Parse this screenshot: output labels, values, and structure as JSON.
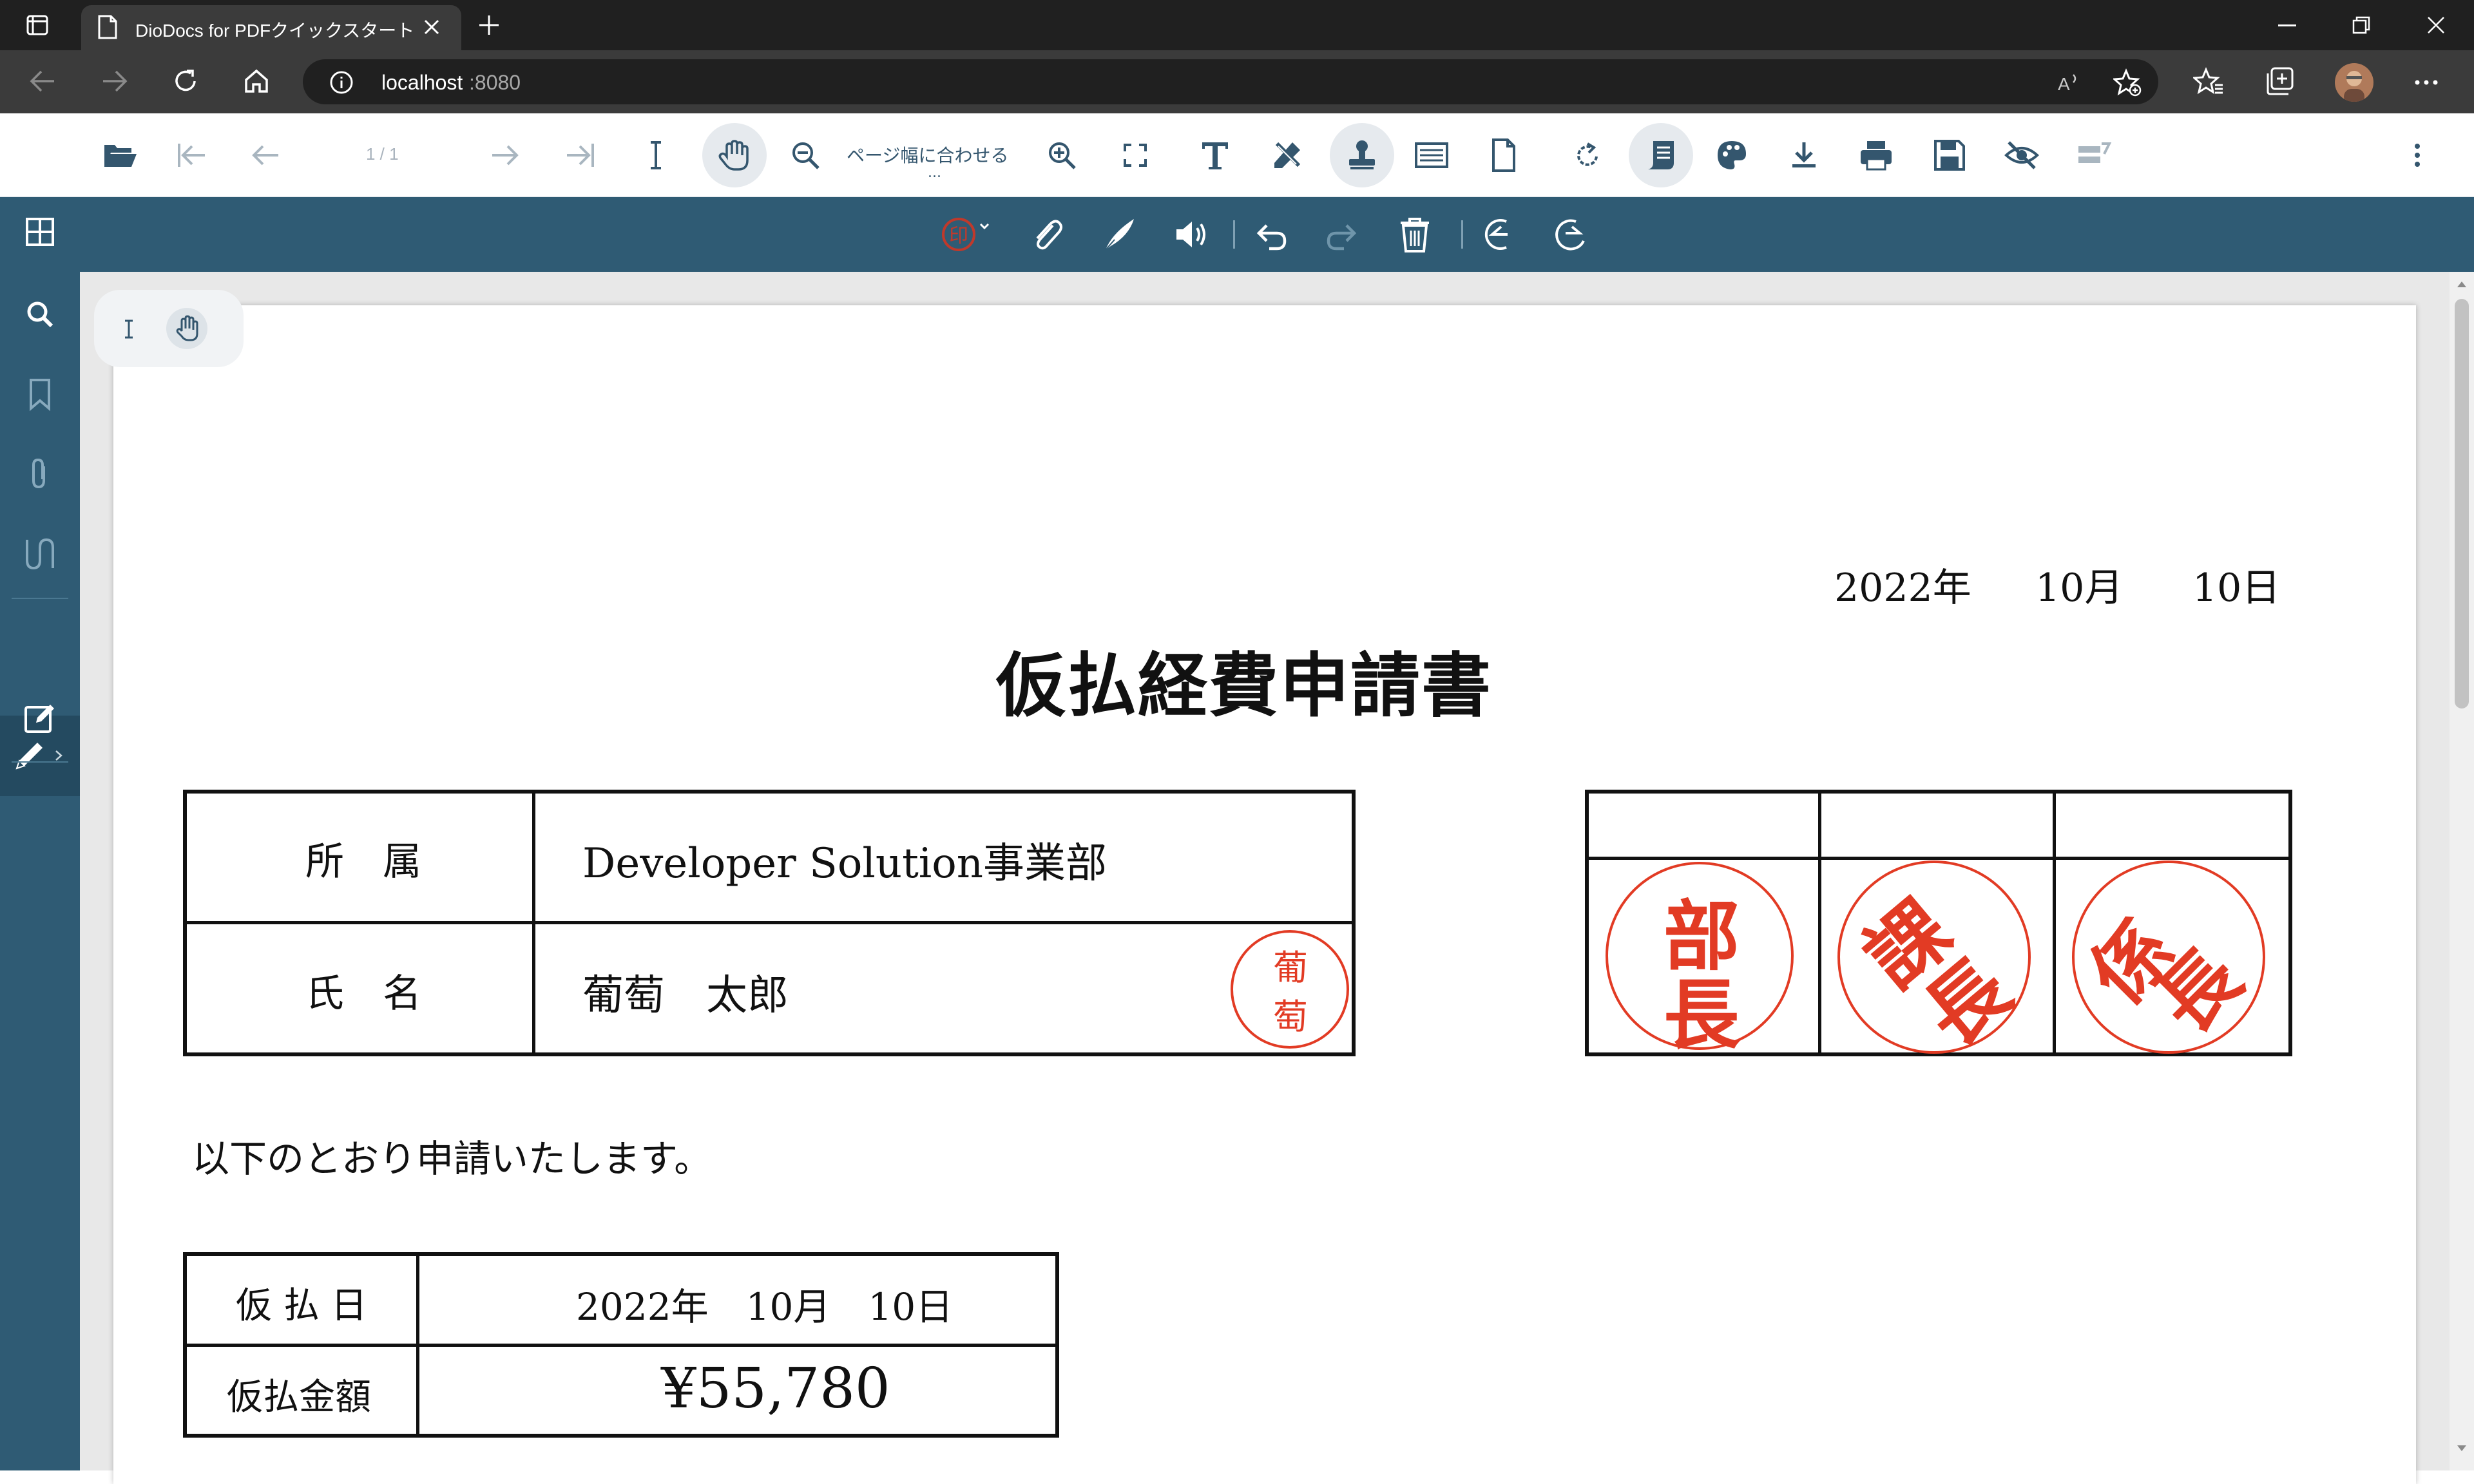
{
  "browser": {
    "tab_title": "DioDocs for PDFクイックスタート | P",
    "url_host": "localhost",
    "url_port": ":8080"
  },
  "viewer": {
    "page_indicator": "1 / 1",
    "zoom_label": "ページ幅に合わせる",
    "zoom_more": "..."
  },
  "document": {
    "date": {
      "year": "2022年",
      "month": "10月",
      "day": "10日"
    },
    "title": "仮払経費申請書",
    "affiliation_label": "所　属",
    "affiliation_value": "Developer Solution事業部",
    "name_label": "氏　名",
    "name_value": "葡萄　太郎",
    "intro": "以下のとおり申請いたします。",
    "advance_date_label": "仮 払 日",
    "advance_date_value": "2022年　10月　10日",
    "amount_label": "仮払金額",
    "amount_value": "¥55,780",
    "stamps": {
      "applicant": [
        "葡",
        "萄"
      ],
      "manager": [
        "部",
        "長"
      ],
      "section_chief": [
        "課",
        "長"
      ],
      "subsection_chief": [
        "係",
        "長"
      ]
    }
  },
  "colors": {
    "sidebar": "#2f5b74",
    "toolbar_icon": "#34566e",
    "stamp_red": "#e23b24"
  }
}
